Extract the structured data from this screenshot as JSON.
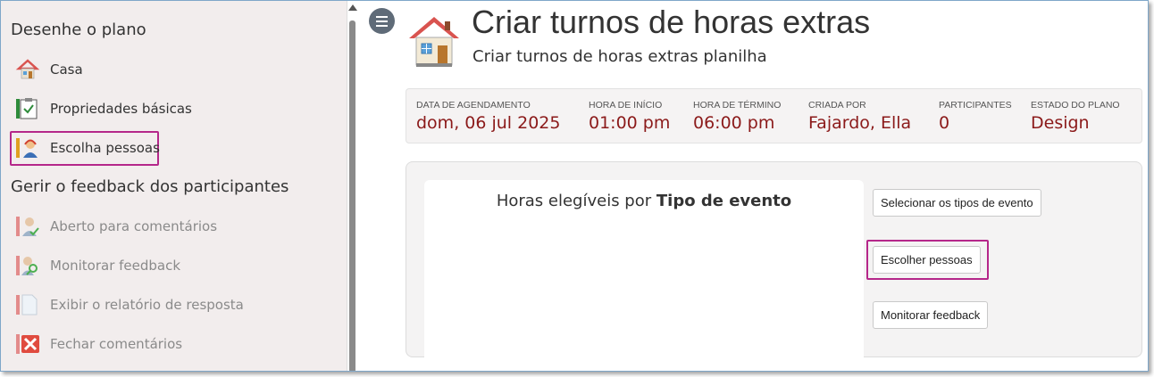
{
  "sidebar": {
    "section1": "Desenhe o plano",
    "section2": "Gerir o feedback dos participantes",
    "items": [
      {
        "label": "Casa",
        "icon": "house-icon"
      },
      {
        "label": "Propriedades básicas",
        "icon": "clipboard-check-icon"
      },
      {
        "label": "Escolha pessoas",
        "icon": "person-headset-icon"
      },
      {
        "label": "Aberto para comentários",
        "icon": "person-check-icon"
      },
      {
        "label": "Monitorar feedback",
        "icon": "person-search-icon"
      },
      {
        "label": "Exibir o relatório de resposta",
        "icon": "document-icon"
      },
      {
        "label": "Fechar comentários",
        "icon": "close-x-icon"
      }
    ]
  },
  "header": {
    "title": "Criar turnos de horas extras",
    "subtitle": "Criar turnos de horas extras planilha"
  },
  "info": [
    {
      "label": "Data de agendamento",
      "value": "dom, 06 jul 2025"
    },
    {
      "label": "Hora de início",
      "value": "01:00 pm"
    },
    {
      "label": "Hora de término",
      "value": "06:00 pm"
    },
    {
      "label": "Criada por",
      "value": "Fajardo, Ella"
    },
    {
      "label": "Participantes",
      "value": "0"
    },
    {
      "label": "Estado do plano",
      "value": "Design"
    }
  ],
  "chart": {
    "title_prefix": "Horas elegíveis por",
    "title_bold": "Tipo de evento"
  },
  "actions": {
    "select_types": "Selecionar os tipos de evento",
    "choose_people": "Escolher pessoas",
    "monitor_feedback": "Monitorar feedback"
  },
  "colors": {
    "highlight": "#b5278a",
    "value_text": "#8b1a1a",
    "sidebar_bg": "#f2eded"
  }
}
